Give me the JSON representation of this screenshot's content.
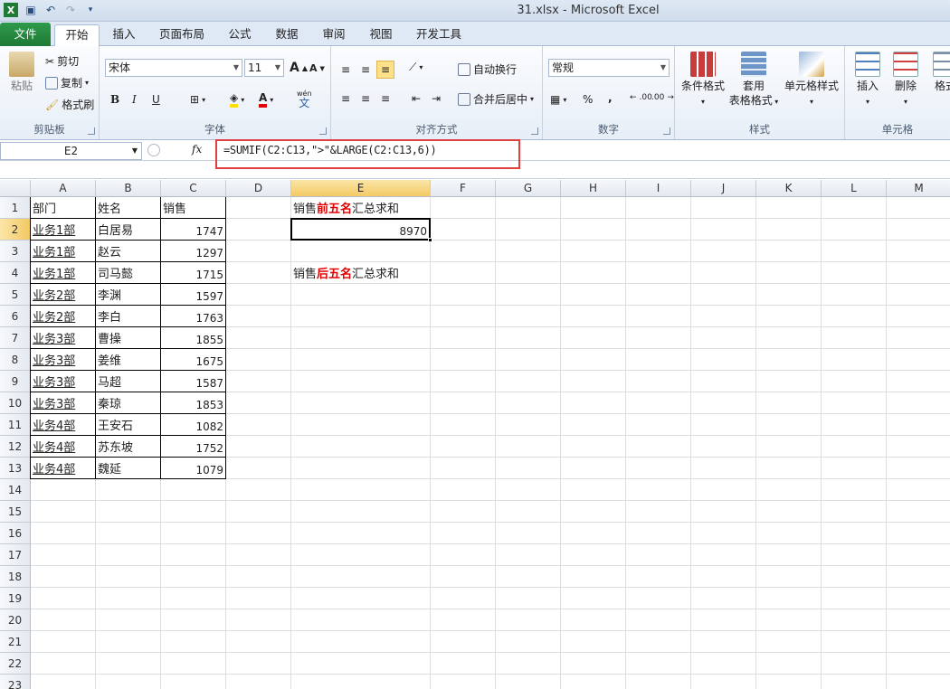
{
  "window": {
    "title": "31.xlsx - Microsoft Excel"
  },
  "tabs": [
    "文件",
    "开始",
    "插入",
    "页面布局",
    "公式",
    "数据",
    "审阅",
    "视图",
    "开发工具"
  ],
  "ribbon": {
    "clipboard": {
      "paste": "粘贴",
      "cut": "剪切",
      "copy": "复制",
      "format_painter": "格式刷",
      "name": "剪贴板"
    },
    "font": {
      "font_name": "宋体",
      "font_size": "11",
      "bold": "B",
      "italic": "I",
      "underline": "U",
      "name": "字体",
      "grow": "A",
      "shrink": "A",
      "wen": "wén",
      "wen_char": "文"
    },
    "alignment": {
      "wrap": "自动换行",
      "merge": "合并后居中",
      "name": "对齐方式"
    },
    "number": {
      "format": "常规",
      "percent": "%",
      "comma": ",",
      "inc": ".00",
      "dec": ".00",
      "name": "数字"
    },
    "styles": {
      "conditional": "条件格式",
      "table_1": "套用",
      "table_2": "表格格式",
      "cell_styles": "单元格样式",
      "name": "样式"
    },
    "cells": {
      "insert": "插入",
      "delete": "删除",
      "format": "格式",
      "name": "单元格"
    }
  },
  "formula_bar": {
    "name_box": "E2",
    "fx": "fx",
    "formula": "=SUMIF(C2:C13,\">\"&LARGE(C2:C13,6))"
  },
  "columns": [
    "A",
    "B",
    "C",
    "D",
    "E",
    "F",
    "G",
    "H",
    "I",
    "J",
    "K",
    "L",
    "M"
  ],
  "rows": [
    "1",
    "2",
    "3",
    "4",
    "5",
    "6",
    "7",
    "8",
    "9",
    "10",
    "11",
    "12",
    "13",
    "14",
    "15",
    "16",
    "17",
    "18",
    "19",
    "20",
    "21",
    "22",
    "23"
  ],
  "table": {
    "headers": [
      "部门",
      "姓名",
      "销售"
    ],
    "data": [
      [
        "业务1部",
        "白居易",
        "1747"
      ],
      [
        "业务1部",
        "赵云",
        "1297"
      ],
      [
        "业务1部",
        "司马懿",
        "1715"
      ],
      [
        "业务2部",
        "李渊",
        "1597"
      ],
      [
        "业务2部",
        "李白",
        "1763"
      ],
      [
        "业务3部",
        "曹操",
        "1855"
      ],
      [
        "业务3部",
        "姜维",
        "1675"
      ],
      [
        "业务3部",
        "马超",
        "1587"
      ],
      [
        "业务3部",
        "秦琼",
        "1853"
      ],
      [
        "业务4部",
        "王安石",
        "1082"
      ],
      [
        "业务4部",
        "苏东坡",
        "1752"
      ],
      [
        "业务4部",
        "魏延",
        "1079"
      ]
    ]
  },
  "labels": {
    "e1": {
      "pre": "销售",
      "emph": "前五名",
      "post": "汇总求和"
    },
    "e2_value": "8970",
    "e4": {
      "pre": "销售",
      "emph": "后五名",
      "post": "汇总求和"
    }
  },
  "colors": {
    "file_tab": "#1e7a35",
    "highlight": "#e04040",
    "emphasis": "#e00000"
  }
}
